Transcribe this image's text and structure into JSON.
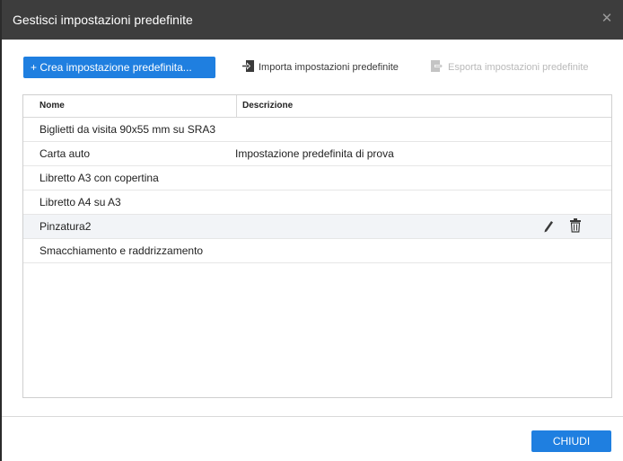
{
  "dialog": {
    "title": "Gestisci impostazioni predefinite",
    "close_glyph": "✕"
  },
  "toolbar": {
    "create_label": "+ Crea impostazione predefinita...",
    "import_label": "Importa impostazioni predefinite",
    "export_label": "Esporta impostazioni predefinite",
    "import_icon": "import-icon",
    "export_icon": "export-icon",
    "export_enabled": false
  },
  "table": {
    "columns": [
      "Nome",
      "Descrizione"
    ],
    "rows": [
      {
        "name": "Biglietti da visita 90x55 mm su SRA3",
        "description": ""
      },
      {
        "name": "Carta auto",
        "description": "Impostazione predefinita di prova"
      },
      {
        "name": "Libretto A3 con copertina",
        "description": ""
      },
      {
        "name": "Libretto A4 su A3",
        "description": ""
      },
      {
        "name": "Pinzatura2",
        "description": "",
        "hovered": true,
        "row_icons": [
          "edit-icon",
          "delete-icon"
        ]
      },
      {
        "name": "Smacchiamento e raddrizzamento",
        "description": ""
      }
    ]
  },
  "footer": {
    "close_label": "CHIUDI"
  },
  "colors": {
    "title_bar": "#3d3d3d",
    "primary_button": "#1f7fe0",
    "hover_row": "#f2f4f7",
    "disabled_text": "#b9b9b9"
  }
}
